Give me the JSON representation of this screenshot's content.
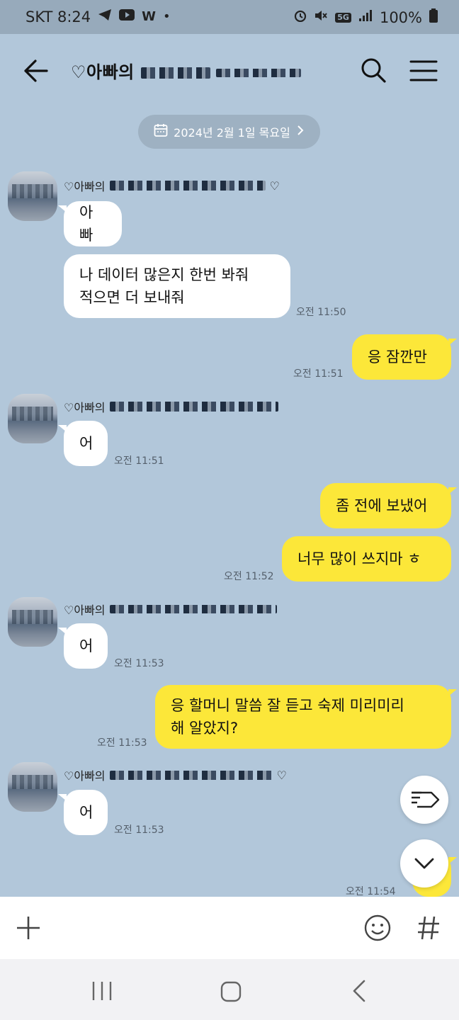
{
  "status": {
    "carrier_time": "SKT 8:24",
    "network_badge": "5G",
    "battery": "100%",
    "left_icons": [
      "telegram-icon",
      "youtube-icon",
      "w-app-icon",
      "dot-icon"
    ],
    "right_icons": [
      "alarm-icon",
      "mute-icon",
      "network-icon",
      "signal-icon",
      "battery-icon"
    ]
  },
  "header": {
    "title_prefix": "♡아빠의"
  },
  "date_divider": "2024년 2월 1일 목요일",
  "sender_prefix": "♡아빠의",
  "messages": [
    {
      "from": "other",
      "text": "아빠"
    },
    {
      "from": "other",
      "text_lines": [
        "나 데이터 많은지 한번 봐줘",
        "적으면 더 보내줘"
      ],
      "time": "오전 11:50"
    },
    {
      "from": "me",
      "text": "응 잠깐만",
      "time": "오전 11:51"
    },
    {
      "from": "other",
      "text": "어",
      "time": "오전 11:51"
    },
    {
      "from": "me",
      "text": "좀 전에 보냈어"
    },
    {
      "from": "me",
      "text": "너무 많이 쓰지마 ㅎ",
      "time": "오전 11:52"
    },
    {
      "from": "other",
      "text": "어",
      "time": "오전 11:53"
    },
    {
      "from": "me",
      "text_lines": [
        "응 할머니 말씀 잘 듣고 숙제 미리미리",
        "해 알았지?"
      ],
      "time": "오전 11:53"
    },
    {
      "from": "other",
      "text": "어",
      "time": "오전 11:53"
    },
    {
      "time": "오전 11:54"
    }
  ],
  "theme": {
    "background": "#b2c7da",
    "my_bubble": "#fce739",
    "their_bubble": "#ffffff"
  }
}
